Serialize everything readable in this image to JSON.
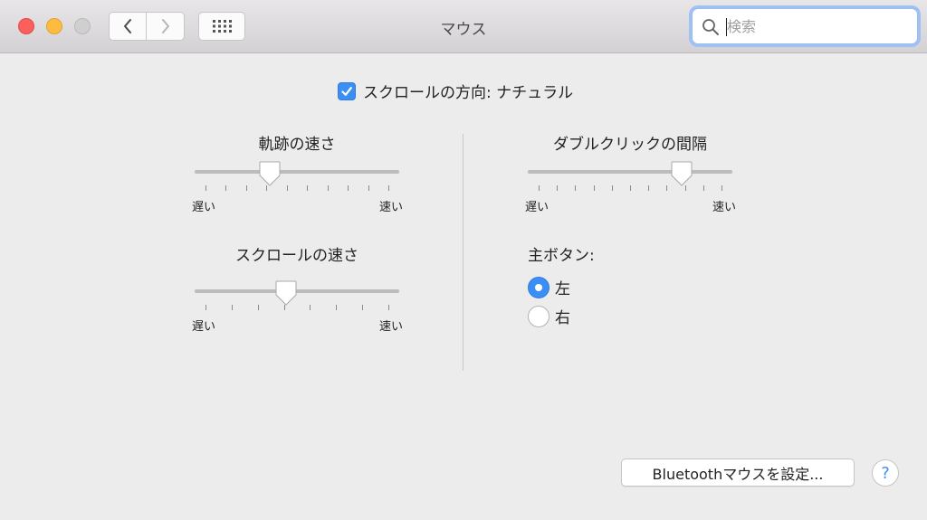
{
  "window": {
    "title": "マウス"
  },
  "toolbar": {
    "back_icon": "chevron-left-icon",
    "forward_icon": "chevron-right-icon",
    "show_all_icon": "grid-icon"
  },
  "search": {
    "placeholder": "検索",
    "value": ""
  },
  "scroll_direction": {
    "label": "スクロールの方向: ナチュラル",
    "checked": true
  },
  "tracking_speed": {
    "title": "軌跡の速さ",
    "min_label": "遅い",
    "max_label": "速い",
    "level": 0.35,
    "ticks": 10
  },
  "scroll_speed": {
    "title": "スクロールの速さ",
    "min_label": "遅い",
    "max_label": "速い",
    "level": 0.44,
    "ticks": 8
  },
  "double_click": {
    "title": "ダブルクリックの間隔",
    "min_label": "遅い",
    "max_label": "速い",
    "level": 0.78,
    "ticks": 11
  },
  "primary_button": {
    "label": "主ボタン:",
    "options": [
      {
        "label": "左",
        "selected": true
      },
      {
        "label": "右",
        "selected": false
      }
    ]
  },
  "bluetooth_button": {
    "label": "Bluetoothマウスを設定..."
  },
  "help_button": {
    "label": "?"
  },
  "colors": {
    "accent": "#3b8ff4",
    "close": "#fc605c",
    "minimize": "#fdbc40"
  }
}
